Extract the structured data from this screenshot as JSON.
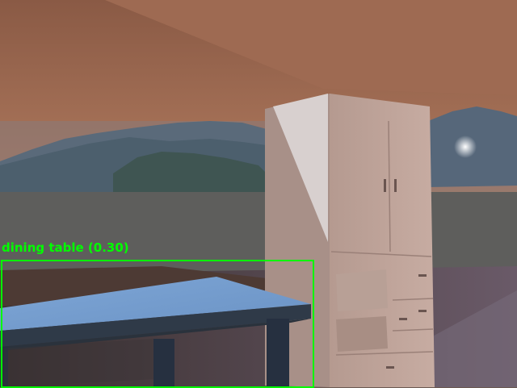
{
  "detection": {
    "label": "dining table (0.30)",
    "color": "#00ff00"
  },
  "scene": {
    "objects": [
      "dining-table",
      "wardrobe-cabinet",
      "mountains",
      "wall",
      "ceiling",
      "floor"
    ]
  }
}
